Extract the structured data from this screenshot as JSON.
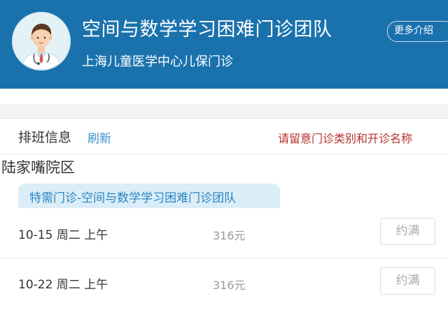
{
  "header": {
    "team_name": "空间与数学学习困难门诊团队",
    "hospital": "上海儿童医学中心儿保门诊",
    "more_button": "更多介绍"
  },
  "schedule": {
    "title": "排班信息",
    "refresh": "刷新",
    "notice": "请留意门诊类别和开诊名称",
    "campus": "陆家嘴院区",
    "clinic_type": "特需门诊-空间与数学学习困难门诊团队",
    "slots": [
      {
        "date": "10-15 周二 上午",
        "price": "316元",
        "status": "约满"
      },
      {
        "date": "10-22 周二 上午",
        "price": "316元",
        "status": "约满"
      }
    ]
  },
  "colors": {
    "header_bg": "#1a72ad",
    "link": "#3a8fcf",
    "notice": "#b5322c",
    "tag_bg": "#dbeef8"
  }
}
